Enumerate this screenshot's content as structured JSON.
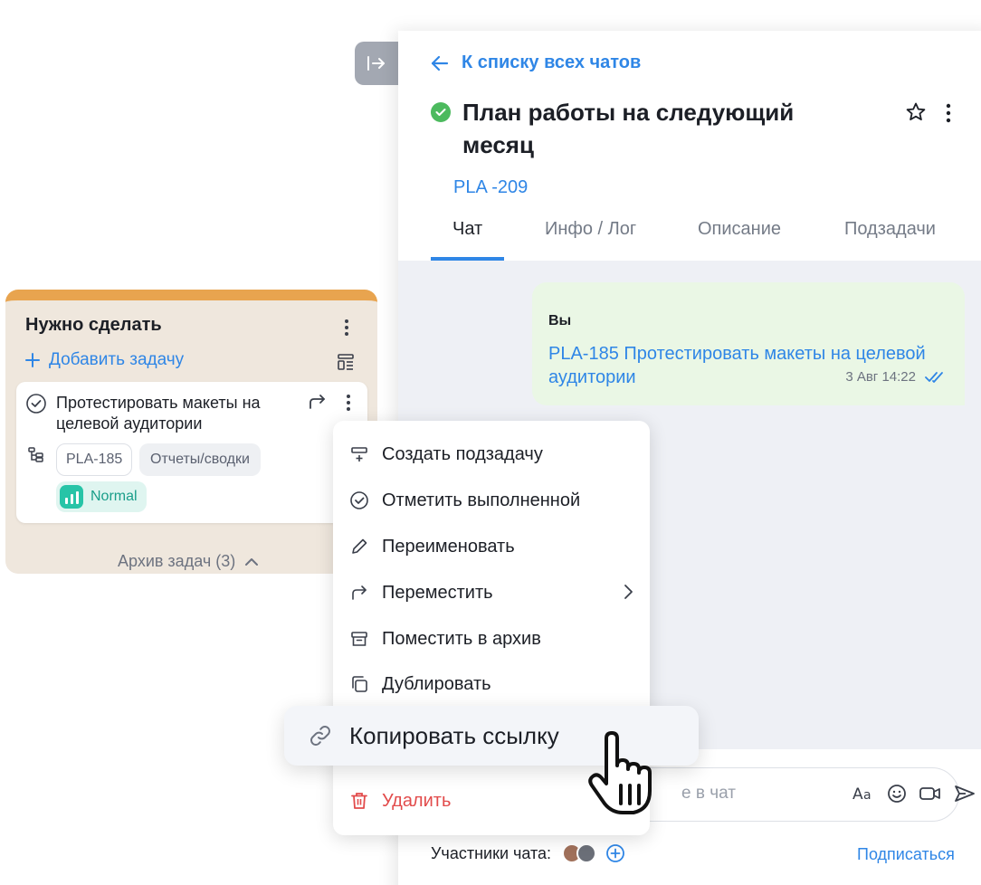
{
  "chat": {
    "back_link": "К списку всех чатов",
    "title": "План работы на следующий месяц",
    "task_id": "PLA -209",
    "tabs": [
      {
        "label": "Чат",
        "active": true
      },
      {
        "label": "Инфо / Лог",
        "active": false
      },
      {
        "label": "Описание",
        "active": false
      },
      {
        "label": "Подзадачи",
        "active": false
      }
    ],
    "message": {
      "author": "Вы",
      "text": "PLA-185 Протестировать макеты на целевой аудитории",
      "timestamp": "3 Авг 14:22"
    },
    "composer": {
      "placeholder": "е в чат"
    },
    "participants_label": "Участники чата:",
    "subscribe_label": "Подписаться"
  },
  "column": {
    "title": "Нужно сделать",
    "add_task_label": "Добавить задачу",
    "archive_label": "Архив задач (3)",
    "task": {
      "title": "Протестировать макеты на целевой аудитории",
      "id_chip": "PLA-185",
      "category_chip": "Отчеты/сводки",
      "priority": "Normal"
    }
  },
  "menu": {
    "items": [
      {
        "label": "Создать подзадачу",
        "icon": "subtask-icon"
      },
      {
        "label": "Отметить выполненной",
        "icon": "check-circle-icon"
      },
      {
        "label": "Переименовать",
        "icon": "pencil-icon"
      },
      {
        "label": "Переместить",
        "icon": "move-arrow-icon"
      },
      {
        "label": "Поместить в архив",
        "icon": "archive-icon"
      },
      {
        "label": "Дублировать",
        "icon": "duplicate-icon"
      },
      {
        "label": "Копировать ссылку",
        "icon": "link-icon"
      },
      {
        "label": "Удалить",
        "icon": "trash-icon"
      }
    ]
  },
  "colors": {
    "accent": "#2f86e6",
    "column_header": "#e8a44f",
    "column_bg": "#efe7dd",
    "success": "#4cba5e",
    "danger": "#e24b4b",
    "priority": "#27c4a7",
    "message_bg": "#eaf7e5"
  }
}
